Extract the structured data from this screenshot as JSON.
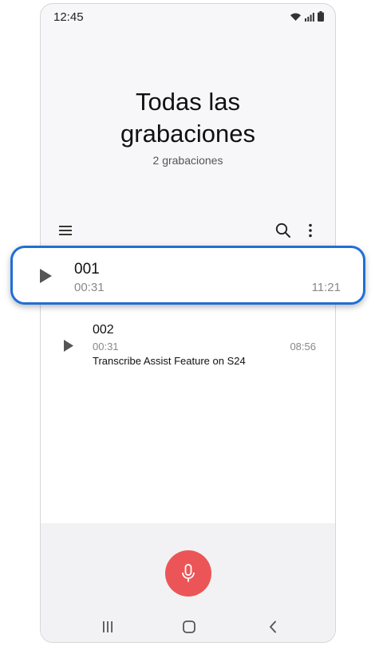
{
  "status_bar": {
    "time": "12:45",
    "icons": [
      "wifi-icon",
      "signal-icon",
      "battery-icon"
    ]
  },
  "header": {
    "title_line1": "Todas las",
    "title_line2": "grabaciones",
    "subtitle": "2 grabaciones"
  },
  "toolbar": {
    "icons": [
      "menu-icon",
      "search-icon",
      "more-options-icon"
    ]
  },
  "recordings": [
    {
      "name": "001",
      "duration": "00:31",
      "date": "11:21",
      "description": ""
    },
    {
      "name": "002",
      "duration": "00:31",
      "date": "08:56",
      "description": "Transcribe Assist Feature on S24"
    }
  ],
  "highlighted_index": 0,
  "bottom": {
    "record_icon": "microphone-icon",
    "record_color": "#ec5557",
    "nav_icons": [
      "recent-apps-icon",
      "home-icon",
      "back-icon"
    ]
  },
  "colors": {
    "highlight_border": "#1f6fd6"
  }
}
